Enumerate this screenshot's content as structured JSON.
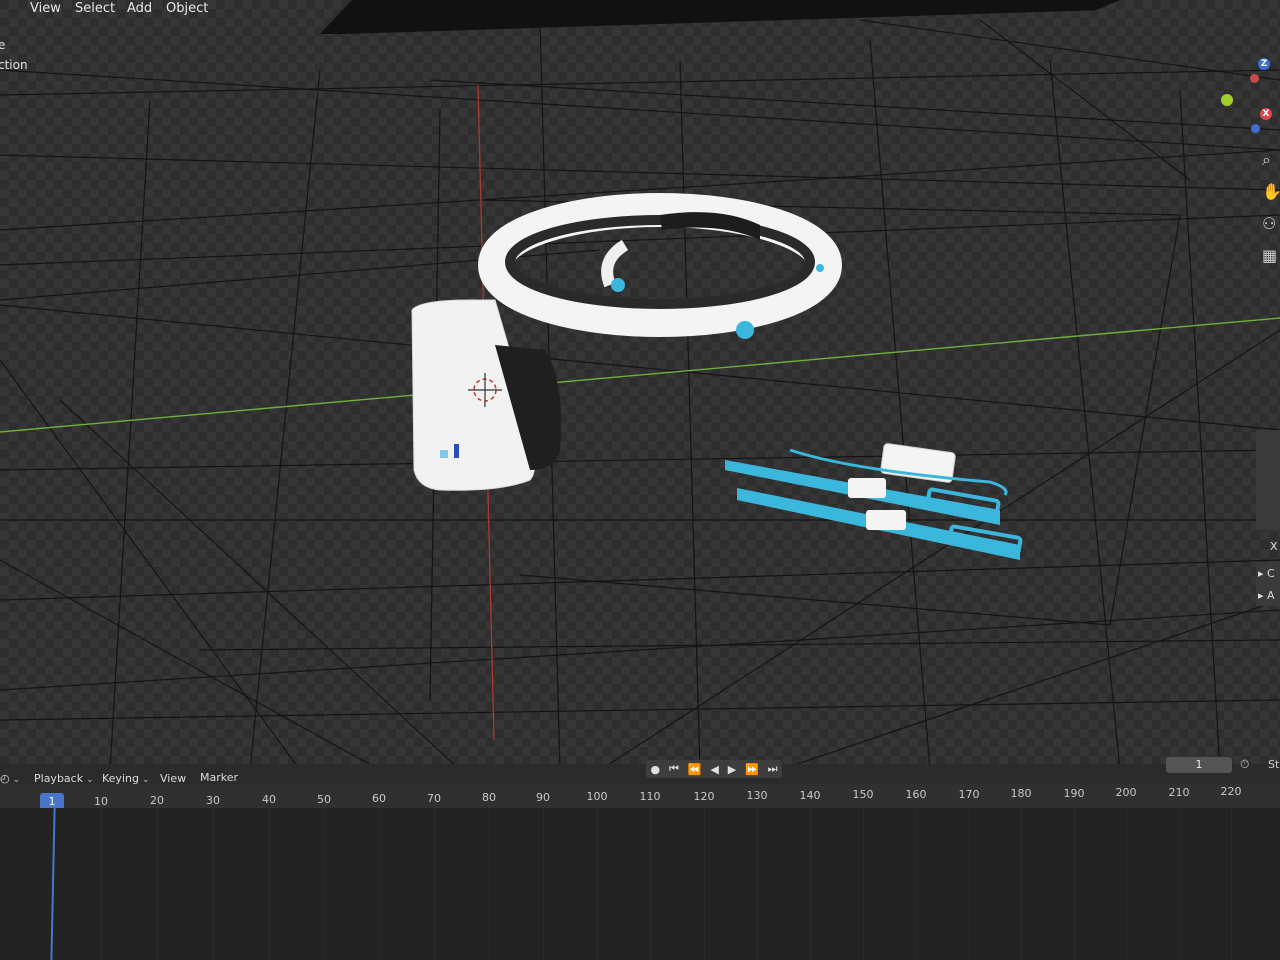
{
  "header_menu": {
    "view": "View",
    "select": "Select",
    "add": "Add",
    "object": "Object"
  },
  "left_cutoff_texts": [
    "e",
    "ction"
  ],
  "gizmo": {
    "z_label": "Z",
    "x_label": "X"
  },
  "right_panel": {
    "row1": "▸ C",
    "row2": "▸ A",
    "x_label": "X"
  },
  "timeline": {
    "menus": [
      "Playback",
      "Keying",
      "View",
      "Marker"
    ],
    "current_frame": "1",
    "frame_field_value": "1",
    "start_label": "St",
    "ruler_ticks": [
      "10",
      "20",
      "30",
      "40",
      "50",
      "60",
      "70",
      "80",
      "90",
      "100",
      "110",
      "120",
      "130",
      "140",
      "150",
      "160",
      "170",
      "180",
      "190",
      "200",
      "210",
      "220"
    ]
  },
  "colors": {
    "accent_blue": "#4a76c9",
    "device_cyan": "#3bb6dc",
    "x_axis_red": "#c0392b",
    "y_axis_green": "#7ac142"
  }
}
